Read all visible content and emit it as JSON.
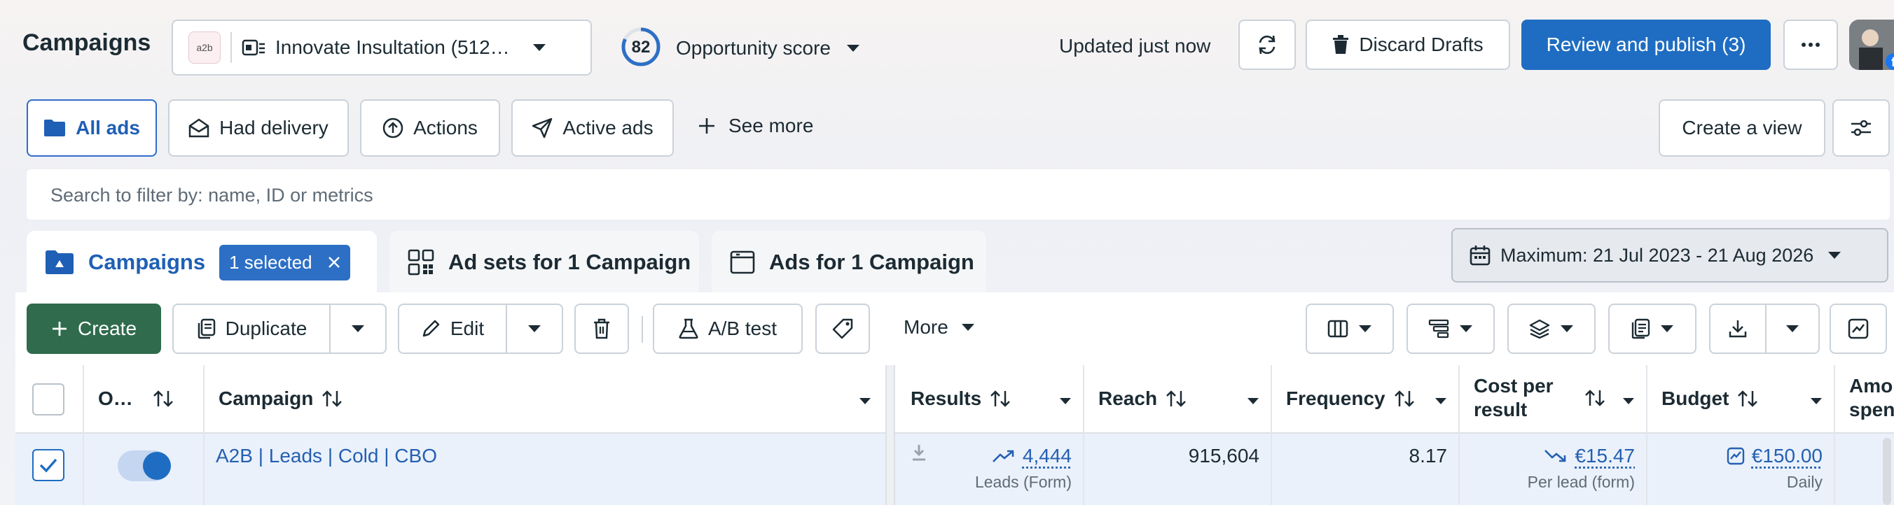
{
  "header": {
    "title": "Campaigns",
    "account_name": "Innovate Insultation (512…",
    "account_badge": "a2b",
    "opportunity_score_value": "82",
    "opportunity_score_label": "Opportunity score",
    "updated_text": "Updated just now",
    "discard_label": "Discard Drafts",
    "publish_label": "Review and publish (3)",
    "more_label": "···"
  },
  "filters": {
    "tabs": [
      {
        "label": "All ads",
        "icon": "folder-icon",
        "active": true
      },
      {
        "label": "Had delivery",
        "icon": "envelope-icon"
      },
      {
        "label": "Actions",
        "icon": "upload-circle-icon"
      },
      {
        "label": "Active ads",
        "icon": "send-icon"
      }
    ],
    "see_more_label": "See more",
    "create_view_label": "Create a view"
  },
  "search": {
    "placeholder": "Search to filter by: name, ID or metrics"
  },
  "levels": {
    "campaigns_label": "Campaigns",
    "selected_label": "1 selected",
    "adsets_label": "Ad sets for 1 Campaign",
    "ads_label": "Ads for 1 Campaign"
  },
  "date_range": {
    "label": "Maximum: 21 Jul 2023 - 21 Aug 2026"
  },
  "toolbar": {
    "create_label": "Create",
    "duplicate_label": "Duplicate",
    "edit_label": "Edit",
    "ab_test_label": "A/B test",
    "more_label": "More"
  },
  "table": {
    "columns": {
      "off_on": "O…",
      "campaign": "Campaign",
      "results": "Results",
      "reach": "Reach",
      "frequency": "Frequency",
      "cost_per_result_line1": "Cost per",
      "cost_per_result_line2": "result",
      "budget": "Budget",
      "amount_spent_line1": "Amou",
      "amount_spent_line2": "spent"
    },
    "rows": [
      {
        "selected": true,
        "enabled": true,
        "campaign": "A2B | Leads | Cold | CBO",
        "results": "4,444",
        "results_sub": "Leads (Form)",
        "reach": "915,604",
        "frequency": "8.17",
        "cost_per_result": "€15.47",
        "cost_per_result_sub": "Per lead (form)",
        "budget": "€150.00",
        "budget_sub": "Daily"
      }
    ]
  },
  "colors": {
    "primary_blue": "#1f6dc2",
    "create_green": "#2f6b4c",
    "link_blue": "#2560b0",
    "selected_row": "#eaf1fb"
  }
}
